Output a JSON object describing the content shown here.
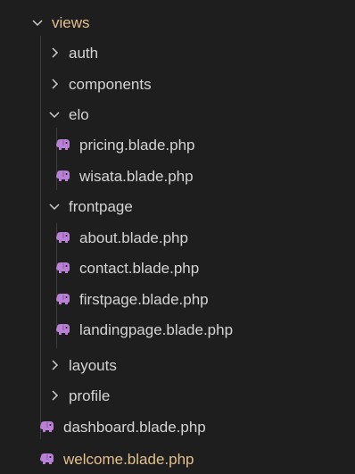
{
  "colors": {
    "background": "#1e1e1e",
    "text": "#d4d4d4",
    "modified_text": "#e2c08d",
    "elephant_icon": "#b981d6"
  },
  "tree": {
    "root": {
      "label": "views",
      "expanded": true
    },
    "items": [
      {
        "label": "auth",
        "type": "folder",
        "expanded": false
      },
      {
        "label": "components",
        "type": "folder",
        "expanded": false
      },
      {
        "label": "elo",
        "type": "folder",
        "expanded": true
      },
      {
        "label": "pricing.blade.php",
        "type": "file",
        "icon": "php-elephant-icon"
      },
      {
        "label": "wisata.blade.php",
        "type": "file",
        "icon": "php-elephant-icon"
      },
      {
        "label": "frontpage",
        "type": "folder",
        "expanded": true
      },
      {
        "label": "about.blade.php",
        "type": "file",
        "icon": "php-elephant-icon"
      },
      {
        "label": "contact.blade.php",
        "type": "file",
        "icon": "php-elephant-icon"
      },
      {
        "label": "firstpage.blade.php",
        "type": "file",
        "icon": "php-elephant-icon"
      },
      {
        "label": "landingpage.blade.php",
        "type": "file",
        "icon": "php-elephant-icon"
      },
      {
        "label": "layouts",
        "type": "folder",
        "expanded": false
      },
      {
        "label": "profile",
        "type": "folder",
        "expanded": false
      },
      {
        "label": "dashboard.blade.php",
        "type": "file",
        "icon": "php-elephant-icon"
      },
      {
        "label": "welcome.blade.php",
        "type": "file",
        "icon": "php-elephant-icon",
        "modified": true
      }
    ]
  }
}
